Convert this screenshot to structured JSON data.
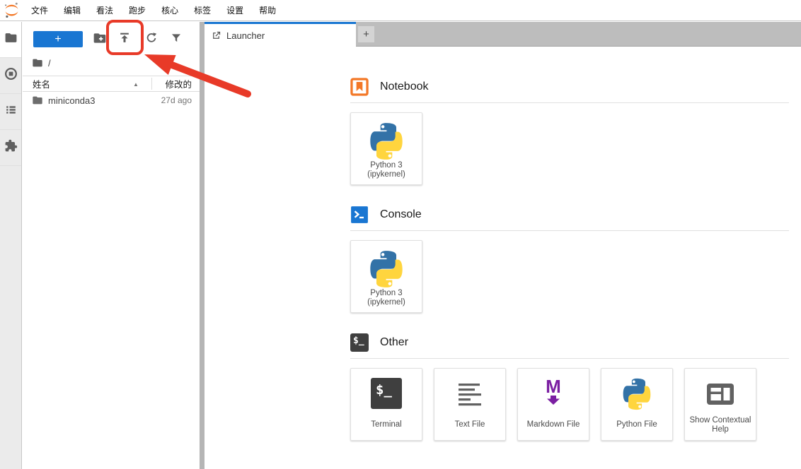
{
  "menu": {
    "items": [
      "文件",
      "编辑",
      "看法",
      "跑步",
      "核心",
      "标签",
      "设置",
      "帮助"
    ]
  },
  "sidebar": {
    "tabs": [
      "file-browser",
      "running-sessions",
      "table-of-contents",
      "extension-manager"
    ]
  },
  "file_browser": {
    "new_launcher_label": "+",
    "breadcrumb_root": "/",
    "sort_indicator": "▲",
    "columns": {
      "name": "姓名",
      "modified": "修改的"
    },
    "rows": [
      {
        "name": "miniconda3",
        "modified": "27d ago"
      }
    ]
  },
  "tabbar": {
    "active_tab": "Launcher",
    "new_tab_label": "+"
  },
  "launcher": {
    "sections": [
      {
        "title": "Notebook",
        "cards": [
          {
            "label": "Python 3",
            "sublabel": "(ipykernel)"
          }
        ]
      },
      {
        "title": "Console",
        "cards": [
          {
            "label": "Python 3",
            "sublabel": "(ipykernel)"
          }
        ]
      },
      {
        "title": "Other",
        "cards": [
          {
            "label": "Terminal"
          },
          {
            "label": "Text File"
          },
          {
            "label": "Markdown File"
          },
          {
            "label": "Python File"
          },
          {
            "label": "Show Contextual Help"
          }
        ]
      }
    ]
  },
  "icons": {
    "terminal_glyph": "$_",
    "markdown_glyph": "M"
  },
  "colors": {
    "accent_blue": "#1976d2",
    "jupyter_orange": "#f37726",
    "annotation_red": "#e83a28",
    "markdown_purple": "#7b1fa2",
    "python_blue": "#3372a7",
    "python_yellow": "#ffd53e"
  }
}
